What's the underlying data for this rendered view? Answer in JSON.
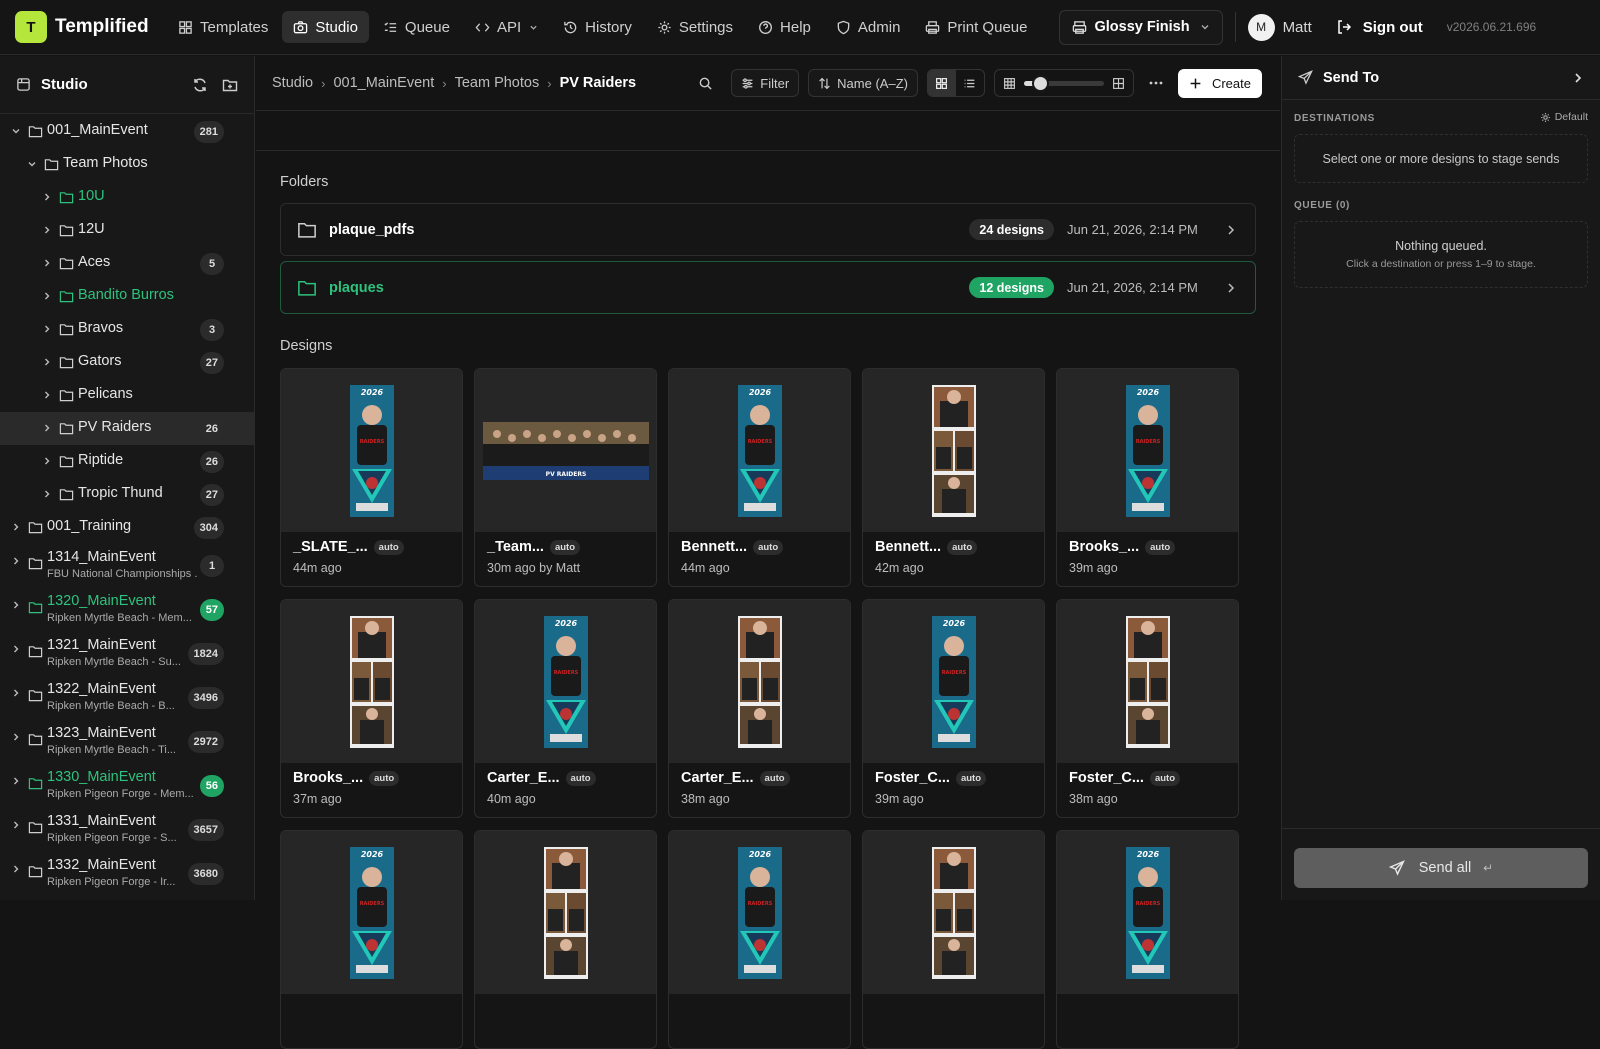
{
  "app": {
    "name": "Templified",
    "logo_letter": "T",
    "version": "v2026.06.21.696"
  },
  "nav": {
    "items": [
      {
        "label": "Templates",
        "icon": "grid-icon"
      },
      {
        "label": "Studio",
        "icon": "camera-icon",
        "active": true
      },
      {
        "label": "Queue",
        "icon": "list-check-icon"
      },
      {
        "label": "API",
        "icon": "code-icon"
      },
      {
        "label": "History",
        "icon": "history-icon"
      },
      {
        "label": "Settings",
        "icon": "gear-icon"
      },
      {
        "label": "Help",
        "icon": "help-icon"
      },
      {
        "label": "Admin",
        "icon": "shield-icon"
      },
      {
        "label": "Print Queue",
        "icon": "printer-icon"
      }
    ],
    "finish": "Glossy Finish",
    "user_initial": "M",
    "user_name": "Matt",
    "sign_out": "Sign out"
  },
  "sidebar": {
    "title": "Studio",
    "tree": [
      {
        "label": "001_MainEvent",
        "count": "281",
        "level": 0,
        "expanded": true
      },
      {
        "label": "Team Photos",
        "count": "",
        "level": 1,
        "expanded": true
      },
      {
        "label": "10U",
        "count": "",
        "level": 2,
        "green": true
      },
      {
        "label": "12U",
        "count": "",
        "level": 2
      },
      {
        "label": "Aces",
        "count": "5",
        "level": 2
      },
      {
        "label": "Bandito Burros",
        "count": "",
        "level": 2,
        "green": true
      },
      {
        "label": "Bravos",
        "count": "3",
        "level": 2
      },
      {
        "label": "Gators",
        "count": "27",
        "level": 2
      },
      {
        "label": "Pelicans",
        "count": "",
        "level": 2
      },
      {
        "label": "PV Raiders",
        "count": "26",
        "level": 2,
        "selected": true
      },
      {
        "label": "Riptide",
        "count": "26",
        "level": 2
      },
      {
        "label": "Tropic Thund",
        "count": "27",
        "level": 2
      },
      {
        "label": "001_Training",
        "count": "304",
        "level": 0
      },
      {
        "label": "1314_MainEvent",
        "sub": "FBU National Championships ...",
        "count": "1",
        "level": 0
      },
      {
        "label": "1320_MainEvent",
        "sub": "Ripken Myrtle Beach - Mem...",
        "count": "57",
        "level": 0,
        "green": true
      },
      {
        "label": "1321_MainEvent",
        "sub": "Ripken Myrtle Beach - Su...",
        "count": "1824",
        "level": 0
      },
      {
        "label": "1322_MainEvent",
        "sub": "Ripken Myrtle Beach - B...",
        "count": "3496",
        "level": 0
      },
      {
        "label": "1323_MainEvent",
        "sub": "Ripken Myrtle Beach - Ti...",
        "count": "2972",
        "level": 0
      },
      {
        "label": "1330_MainEvent",
        "sub": "Ripken Pigeon Forge - Mem...",
        "count": "56",
        "level": 0,
        "green": true
      },
      {
        "label": "1331_MainEvent",
        "sub": "Ripken Pigeon Forge - S...",
        "count": "3657",
        "level": 0
      },
      {
        "label": "1332_MainEvent",
        "sub": "Ripken Pigeon Forge - Ir...",
        "count": "3680",
        "level": 0
      }
    ]
  },
  "breadcrumb": [
    "Studio",
    "001_MainEvent",
    "Team Photos",
    "PV Raiders"
  ],
  "toolbar": {
    "filter": "Filter",
    "sort": "Name (A–Z)",
    "create": "Create",
    "zoom_level": 0.2
  },
  "sections": {
    "folders": "Folders",
    "designs": "Designs"
  },
  "folders": [
    {
      "name": "plaque_pdfs",
      "badge": "24 designs",
      "date": "Jun 21, 2026, 2:14 PM"
    },
    {
      "name": "plaques",
      "badge": "12 designs",
      "date": "Jun 21, 2026, 2:14 PM",
      "green": true
    }
  ],
  "designs": [
    {
      "name": "_SLATE_...",
      "tag": "auto",
      "time": "44m ago",
      "kind": "card"
    },
    {
      "name": "_Team...",
      "tag": "auto",
      "time": "30m ago by Matt",
      "kind": "team"
    },
    {
      "name": "Bennett...",
      "tag": "auto",
      "time": "44m ago",
      "kind": "card"
    },
    {
      "name": "Bennett...",
      "tag": "auto",
      "time": "42m ago",
      "kind": "collage"
    },
    {
      "name": "Brooks_...",
      "tag": "auto",
      "time": "39m ago",
      "kind": "card"
    },
    {
      "name": "Brooks_...",
      "tag": "auto",
      "time": "37m ago",
      "kind": "collage"
    },
    {
      "name": "Carter_E...",
      "tag": "auto",
      "time": "40m ago",
      "kind": "card"
    },
    {
      "name": "Carter_E...",
      "tag": "auto",
      "time": "38m ago",
      "kind": "collage"
    },
    {
      "name": "Foster_C...",
      "tag": "auto",
      "time": "39m ago",
      "kind": "card"
    },
    {
      "name": "Foster_C...",
      "tag": "auto",
      "time": "38m ago",
      "kind": "collage"
    },
    {
      "kind": "card"
    },
    {
      "kind": "collage"
    },
    {
      "kind": "card"
    },
    {
      "kind": "collage"
    },
    {
      "kind": "card"
    }
  ],
  "send_to": {
    "title": "Send To",
    "destinations_label": "DESTINATIONS",
    "default_label": "Default",
    "destinations_empty": "Select one or more designs to stage sends",
    "queue_label": "QUEUE (0)",
    "queue_empty_title": "Nothing queued.",
    "queue_empty_hint": "Click a destination or press 1–9 to stage.",
    "send_all": "Send all"
  },
  "colors": {
    "accent_green": "#2ec27e",
    "logo": "#b5e63b",
    "badge_green": "#1fa463"
  }
}
